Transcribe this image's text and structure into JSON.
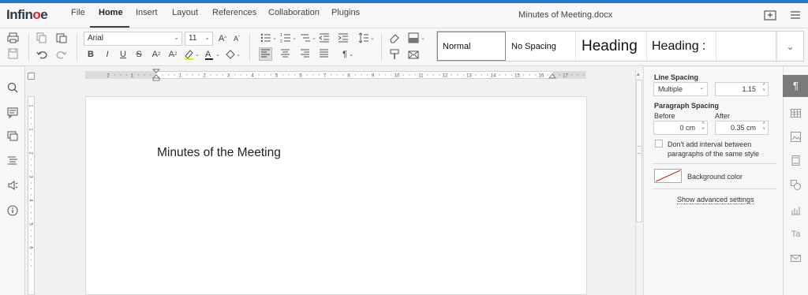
{
  "app": {
    "logo_text_a": "Infin",
    "logo_text_o": "o",
    "logo_text_b": "e",
    "document_title": "Minutes of Meeting.docx"
  },
  "menu_tabs": [
    "File",
    "Home",
    "Insert",
    "Layout",
    "References",
    "Collaboration",
    "Plugins"
  ],
  "toolbar": {
    "font_name": "Arial",
    "font_size": "11",
    "styles": [
      "Normal",
      "No Spacing",
      "Heading",
      "Heading :"
    ]
  },
  "document": {
    "heading": "Minutes of the Meeting"
  },
  "ruler": {
    "h_labels": [
      "2",
      "1",
      "1",
      "2",
      "3",
      "4",
      "5",
      "6",
      "7",
      "8",
      "9",
      "10",
      "11",
      "12",
      "13",
      "14",
      "15",
      "16",
      "17"
    ],
    "v_labels": [
      "1",
      "1",
      "2",
      "3",
      "4",
      "5",
      "6"
    ]
  },
  "paragraph_panel": {
    "line_spacing_label": "Line Spacing",
    "line_spacing_mode": "Multiple",
    "line_spacing_value": "1.15",
    "paragraph_spacing_label": "Paragraph Spacing",
    "before_label": "Before",
    "before_value": "0 cm",
    "after_label": "After",
    "after_value": "0.35 cm",
    "no_interval_label_1": "Don't add interval between",
    "no_interval_label_2": "paragraphs of the same style",
    "background_color_label": "Background color",
    "advanced_settings_label": "Show advanced settings"
  },
  "colors": {
    "brand_blue": "#2a78c4",
    "logo_red": "#d8232a",
    "active_rail": "#7a7a7a"
  }
}
